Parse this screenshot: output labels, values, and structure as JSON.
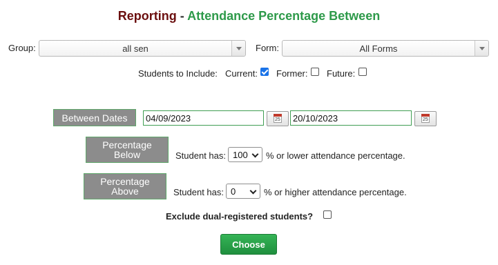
{
  "title": {
    "part1": "Reporting",
    "sep": " - ",
    "part2": "Attendance Percentage Between"
  },
  "filters": {
    "group_label": "Group:",
    "group_value": "all sen",
    "form_label": "Form:",
    "form_value": "All Forms"
  },
  "include": {
    "label": "Students to Include:",
    "current_label": "Current:",
    "current_checked": true,
    "former_label": "Former:",
    "former_checked": false,
    "future_label": "Future:",
    "future_checked": false
  },
  "between": {
    "button_label": "Between Dates",
    "from_date": "04/09/2023",
    "to_date": "20/10/2023",
    "calendar_day": "25"
  },
  "below": {
    "button_line1": "Percentage",
    "button_line2": "Below",
    "student_has": "Student has:",
    "value": "100",
    "suffix": "% or lower attendance percentage."
  },
  "above": {
    "button_line1": "Percentage",
    "button_line2": "Above",
    "student_has": "Student has:",
    "value": "0",
    "suffix": "% or higher attendance percentage."
  },
  "exclude": {
    "label": "Exclude dual-registered students?",
    "checked": false
  },
  "choose_label": "Choose"
}
